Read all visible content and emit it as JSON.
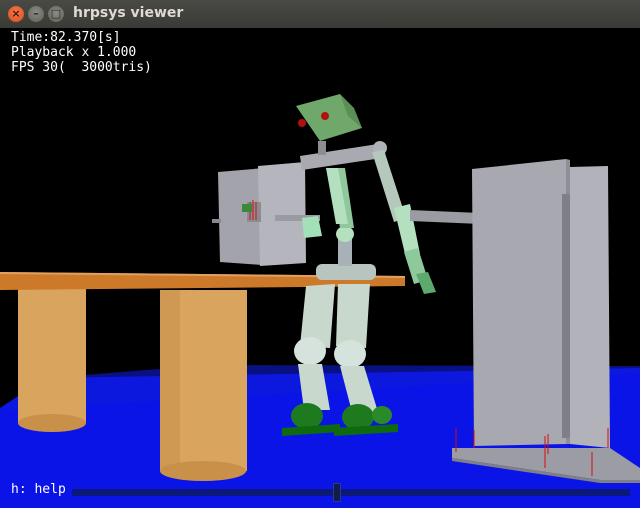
{
  "window": {
    "title": "hrpsys viewer",
    "close_glyph": "×",
    "minimize_glyph": "–",
    "maximize_glyph": "□"
  },
  "hud": {
    "time": "Time:82.370[s]",
    "playback": "Playback x 1.000",
    "fps": "FPS 30(  3000tris)"
  },
  "footer": {
    "help": "h: help",
    "slider_position": 0.475
  },
  "colors": {
    "background": "#000000",
    "floor": "#0a14e6",
    "table_top": "#cc7a2a",
    "table_legs": "#d9a45e",
    "robot_head": "#6fa86a",
    "robot_body": "#c8d8cc",
    "feet": "#1e7a1e",
    "walls": "#a8a8b0",
    "slider_track": "#0b1a7a"
  }
}
